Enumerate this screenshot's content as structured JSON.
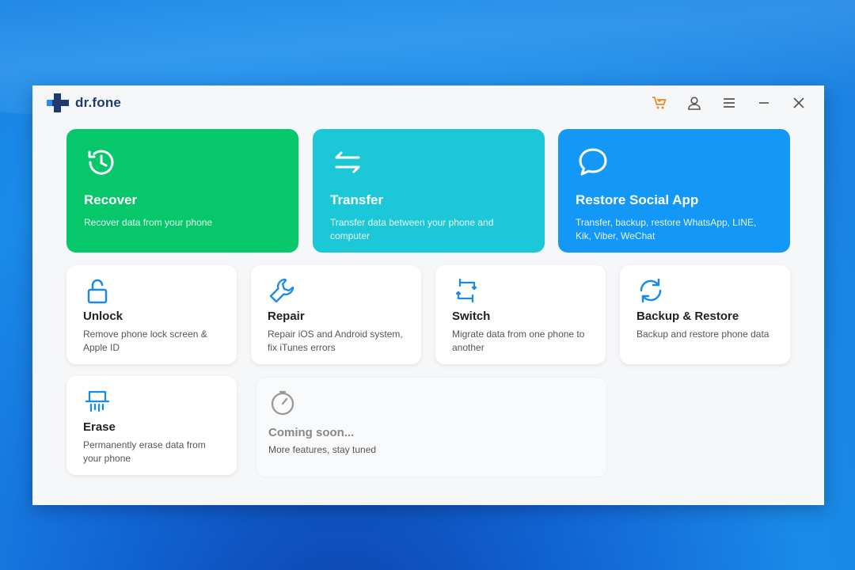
{
  "app": {
    "logo_text": "dr.fone",
    "brand_color": "#1e3a6e",
    "window_controls": [
      {
        "name": "cart-icon",
        "color": "#f08a1c"
      },
      {
        "name": "user-icon"
      },
      {
        "name": "menu-icon"
      },
      {
        "name": "minimize-icon"
      },
      {
        "name": "close-icon"
      }
    ]
  },
  "features": {
    "recover": {
      "title": "Recover",
      "desc": "Recover data from your phone",
      "color": "#06c76a",
      "icon": "clock-restore-icon"
    },
    "transfer": {
      "title": "Transfer",
      "desc": "Transfer data between your phone and computer",
      "color": "#1cc8d8",
      "icon": "transfer-arrows-icon"
    },
    "social": {
      "title": "Restore Social App",
      "desc": "Transfer, backup, restore WhatsApp, LINE, Kik, Viber, WeChat",
      "color": "#1498f8",
      "icon": "chat-bubble-icon"
    },
    "unlock": {
      "title": "Unlock",
      "desc": "Remove phone lock screen & Apple ID",
      "icon": "padlock-icon"
    },
    "repair": {
      "title": "Repair",
      "desc": "Repair iOS and Android system, fix iTunes errors",
      "icon": "wrench-icon"
    },
    "switch": {
      "title": "Switch",
      "desc": "Migrate data from one phone to another",
      "icon": "phone-switch-icon"
    },
    "backup": {
      "title": "Backup & Restore",
      "desc": "Backup and restore phone data",
      "icon": "sync-icon"
    },
    "erase": {
      "title": "Erase",
      "desc": "Permanently erase data from your phone",
      "icon": "shredder-icon"
    },
    "coming_soon": {
      "title": "Coming soon...",
      "desc": "More features, stay tuned",
      "icon": "timer-icon"
    }
  }
}
